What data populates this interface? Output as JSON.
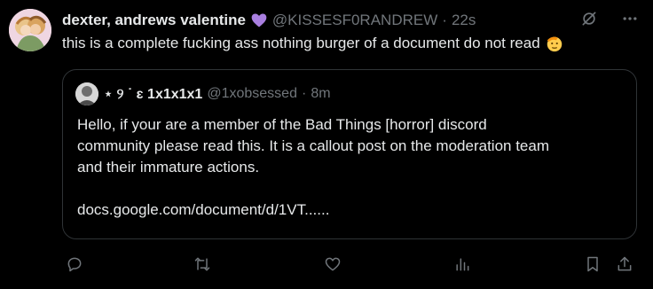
{
  "tweet": {
    "display_name": "dexter, andrews valentine",
    "handle": "@KISSESF0RANDREW",
    "separator": "·",
    "time": "22s",
    "text": "this is a complete fucking ass nothing burger of a document do not read",
    "badge_icon": "purple-heart-icon",
    "emoji_icon": "saluting-face-emoji"
  },
  "quote": {
    "display_name": "⋆ ୨ ˙ ɛ 1x1x1x1",
    "handle": "@1xobsessed",
    "separator": "·",
    "time": "8m",
    "body_line1": "Hello, if your are a member of the Bad Things [horror] discord",
    "body_line2": "community please read this. It is a callout post on the moderation team",
    "body_line3": "and their immature actions.",
    "link": "docs.google.com/document/d/1VT......"
  },
  "action_icons": [
    "reply-icon",
    "repost-icon",
    "like-icon",
    "views-icon",
    "bookmark-icon",
    "share-icon"
  ],
  "colors": {
    "background": "#000000",
    "text": "#e7e9ea",
    "muted": "#71767b",
    "border": "#2f3336",
    "heart": "#a97fe0"
  }
}
